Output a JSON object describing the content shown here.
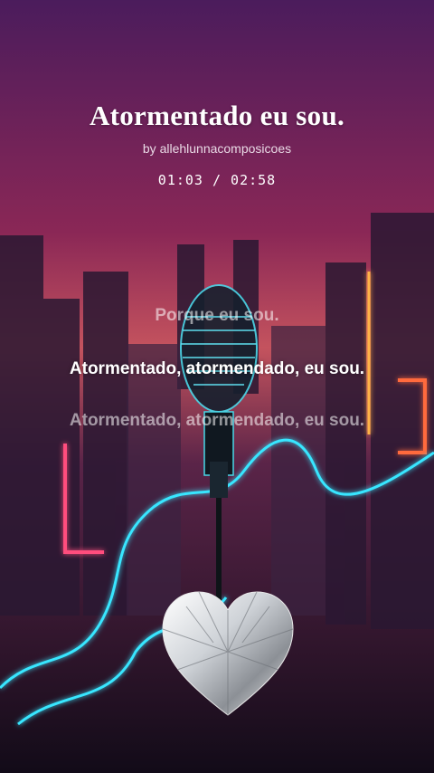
{
  "song": {
    "title": "Atormentado eu sou.",
    "author": "by allehlunnacomposicoes",
    "time": "01:03 / 02:58"
  },
  "lyrics": {
    "previous": "Porque eu sou.",
    "current": "Atormentado, atormendado, eu sou.",
    "next": "Atormentado, atormendado, eu sou."
  },
  "icons": {
    "background": "neon-city-microphone-image",
    "heart": "diamond-heart-icon"
  },
  "colors": {
    "neon_cyan": "#38e6ff",
    "neon_pink": "#ff4d7d",
    "neon_orange": "#ffb347"
  }
}
